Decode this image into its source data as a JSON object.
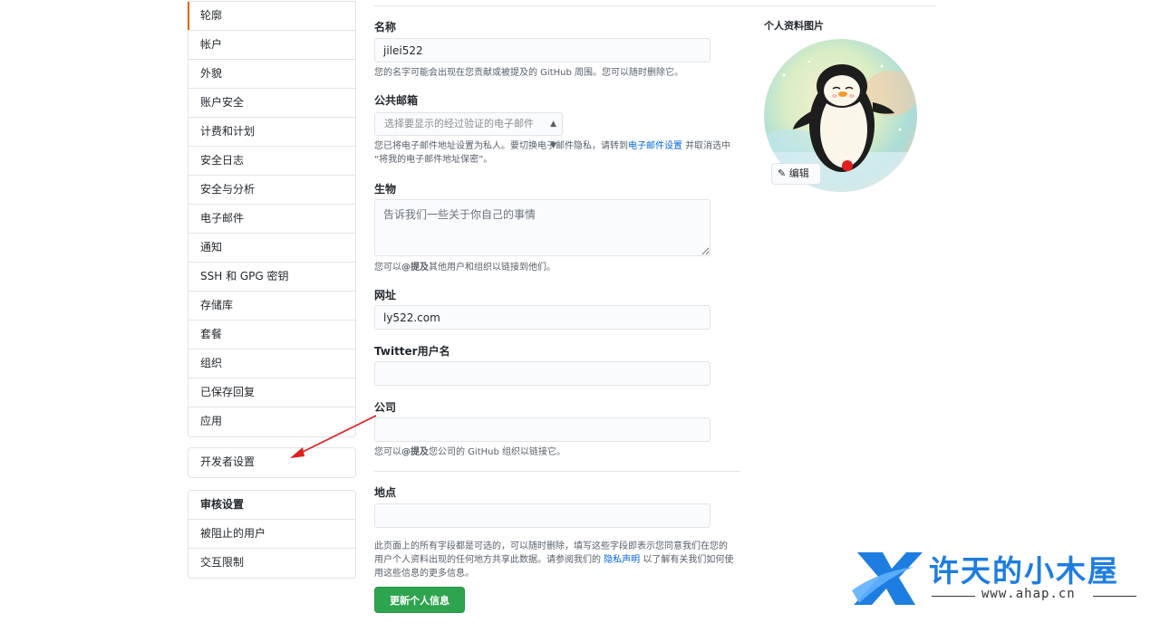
{
  "sidebar": {
    "main_items": [
      {
        "label": "轮廓",
        "selected": true
      },
      {
        "label": "帐户"
      },
      {
        "label": "外貌"
      },
      {
        "label": "账户安全"
      },
      {
        "label": "计费和计划"
      },
      {
        "label": "安全日志"
      },
      {
        "label": "安全与分析"
      },
      {
        "label": "电子邮件"
      },
      {
        "label": "通知"
      },
      {
        "label": "SSH 和 GPG 密钥"
      },
      {
        "label": "存储库"
      },
      {
        "label": "套餐"
      },
      {
        "label": "组织"
      },
      {
        "label": "已保存回复"
      },
      {
        "label": "应用"
      }
    ],
    "developer_settings": "开发者设置",
    "moderation": {
      "heading": "审核设置",
      "items": [
        "被阻止的用户",
        "交互限制"
      ]
    }
  },
  "form": {
    "name": {
      "label": "名称",
      "value": "jilei522",
      "note": "您的名字可能会出现在您贡献或被提及的 GitHub 周围。您可以随时删除它。"
    },
    "public_email": {
      "label": "公共邮箱",
      "select_value": "选择要显示的经过验证的电子邮件",
      "note_before": "您已将电子邮件地址设置为私人。要切换电子邮件隐私，请转到",
      "note_link": "电子邮件设置",
      "note_after": " 并取消选中",
      "note_line2": "“将我的电子邮件地址保密”。"
    },
    "bio": {
      "label": "生物",
      "placeholder": "告诉我们一些关于你自己的事情",
      "note_before": "您可以",
      "note_bold": "@提及",
      "note_after": "其他用户和组织以链接到他们。"
    },
    "url": {
      "label": "网址",
      "value": "ly522.com"
    },
    "twitter": {
      "label": "Twitter用户名",
      "value": ""
    },
    "company": {
      "label": "公司",
      "value": "",
      "note_before": "您可以",
      "note_bold": "@提及",
      "note_after": "您公司的 GitHub 组织以链接它。"
    },
    "location": {
      "label": "地点",
      "value": ""
    },
    "footer_note_line1": "此页面上的所有字段都是可选的，可以随时删除，填写这些字段即表示您同意我们在您的",
    "footer_note_line2_before": "用户个人资料出现的任何地方共享此数据。请参阅我们的 ",
    "footer_note_link": "隐私声明",
    "footer_note_line2_after": " 以了解有关我们如何使",
    "footer_note_line3": "用这些信息的更多信息。",
    "submit_label": "更新个人信息"
  },
  "avatar": {
    "title": "个人资料图片",
    "edit_label": "编辑",
    "image_icon": "penguin-avatar"
  },
  "watermark": {
    "title": "许天的小木屋",
    "url": "www.ahap.cn",
    "color": "#1e7de0"
  },
  "colors": {
    "accent_selected": "#e36209",
    "button_green": "#2ea44f",
    "link_blue": "#0366d6",
    "annotation_arrow": "#e02020"
  }
}
